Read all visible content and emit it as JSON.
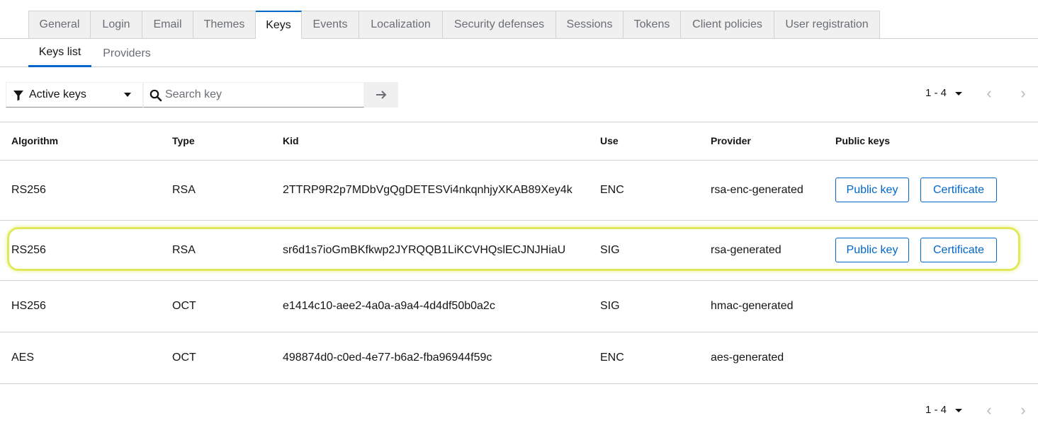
{
  "top_tabs": [
    "General",
    "Login",
    "Email",
    "Themes",
    "Keys",
    "Events",
    "Localization",
    "Security defenses",
    "Sessions",
    "Tokens",
    "Client policies",
    "User registration"
  ],
  "active_top_tab": "Keys",
  "sub_tabs": [
    "Keys list",
    "Providers"
  ],
  "active_sub_tab": "Keys list",
  "toolbar": {
    "filter_label": "Active keys",
    "search_placeholder": "Search key",
    "search_value": ""
  },
  "pagination": {
    "range": "1 - 4"
  },
  "table": {
    "headers": [
      "Algorithm",
      "Type",
      "Kid",
      "Use",
      "Provider",
      "Public keys"
    ],
    "rows": [
      {
        "algorithm": "RS256",
        "type": "RSA",
        "kid": "2TTRP9R2p7MDbVgQgDETESVi4nkqnhjyXKAB89Xey4k",
        "use": "ENC",
        "provider": "rsa-enc-generated",
        "public_key_label": "Public key",
        "certificate_label": "Certificate"
      },
      {
        "algorithm": "RS256",
        "type": "RSA",
        "kid": "sr6d1s7ioGmBKfkwp2JYRQQB1LiKCVHQslECJNJHiaU",
        "use": "SIG",
        "provider": "rsa-generated",
        "public_key_label": "Public key",
        "certificate_label": "Certificate"
      },
      {
        "algorithm": "HS256",
        "type": "OCT",
        "kid": "e1414c10-aee2-4a0a-a9a4-4d4df50b0a2c",
        "use": "SIG",
        "provider": "hmac-generated"
      },
      {
        "algorithm": "AES",
        "type": "OCT",
        "kid": "498874d0-c0ed-4e77-b6a2-fba96944f59c",
        "use": "ENC",
        "provider": "aes-generated"
      }
    ]
  },
  "highlighted_row": 1,
  "colors": {
    "accent": "#0066cc",
    "highlight": "#e1e85a",
    "tab_bg": "#f0f0f0"
  }
}
